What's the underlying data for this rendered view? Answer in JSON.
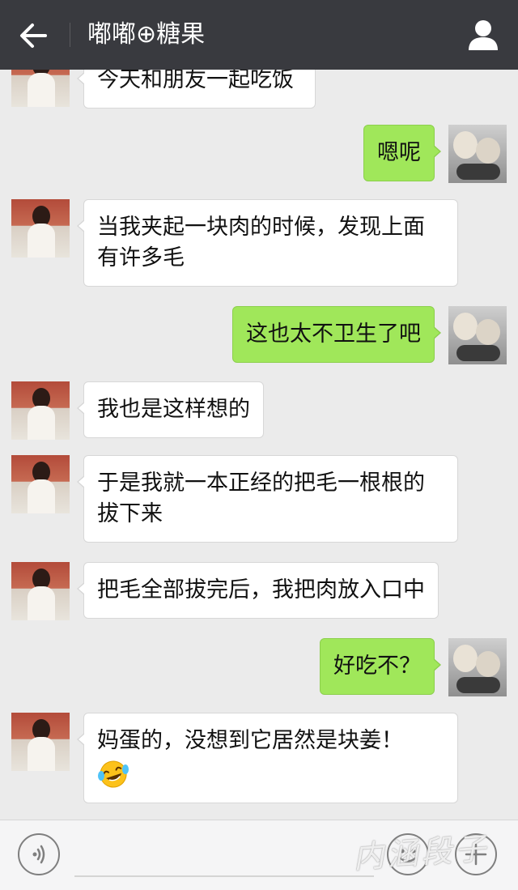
{
  "header": {
    "title": "嘟嘟⊕糖果",
    "back_icon": "arrow-left-icon",
    "profile_icon": "user-icon"
  },
  "messages": [
    {
      "side": "left",
      "text": "今天和朋友一起吃饭"
    },
    {
      "side": "right",
      "text": "嗯呢"
    },
    {
      "side": "left",
      "text": "当我夹起一块肉的时候，发现上面有许多毛"
    },
    {
      "side": "right",
      "text": "这也太不卫生了吧"
    },
    {
      "side": "left",
      "text": "我也是这样想的"
    },
    {
      "side": "left",
      "text": "于是我就一本正经的把毛一根根的拔下来"
    },
    {
      "side": "left",
      "text": "把毛全部拔完后，我把肉放入口中"
    },
    {
      "side": "right",
      "text": "好吃不？"
    },
    {
      "side": "left",
      "text": "妈蛋的，没想到它居然是块姜！",
      "emoji": "crying-laughing-emoji"
    }
  ],
  "input_bar": {
    "voice_icon": "voice-icon",
    "emoji_icon": "smiley-icon",
    "plus_icon": "plus-icon"
  },
  "watermark": "内涵段子",
  "colors": {
    "header_bg": "#393a3f",
    "chat_bg": "#ebebeb",
    "sent_bubble": "#a0e75a",
    "received_bubble": "#ffffff"
  }
}
